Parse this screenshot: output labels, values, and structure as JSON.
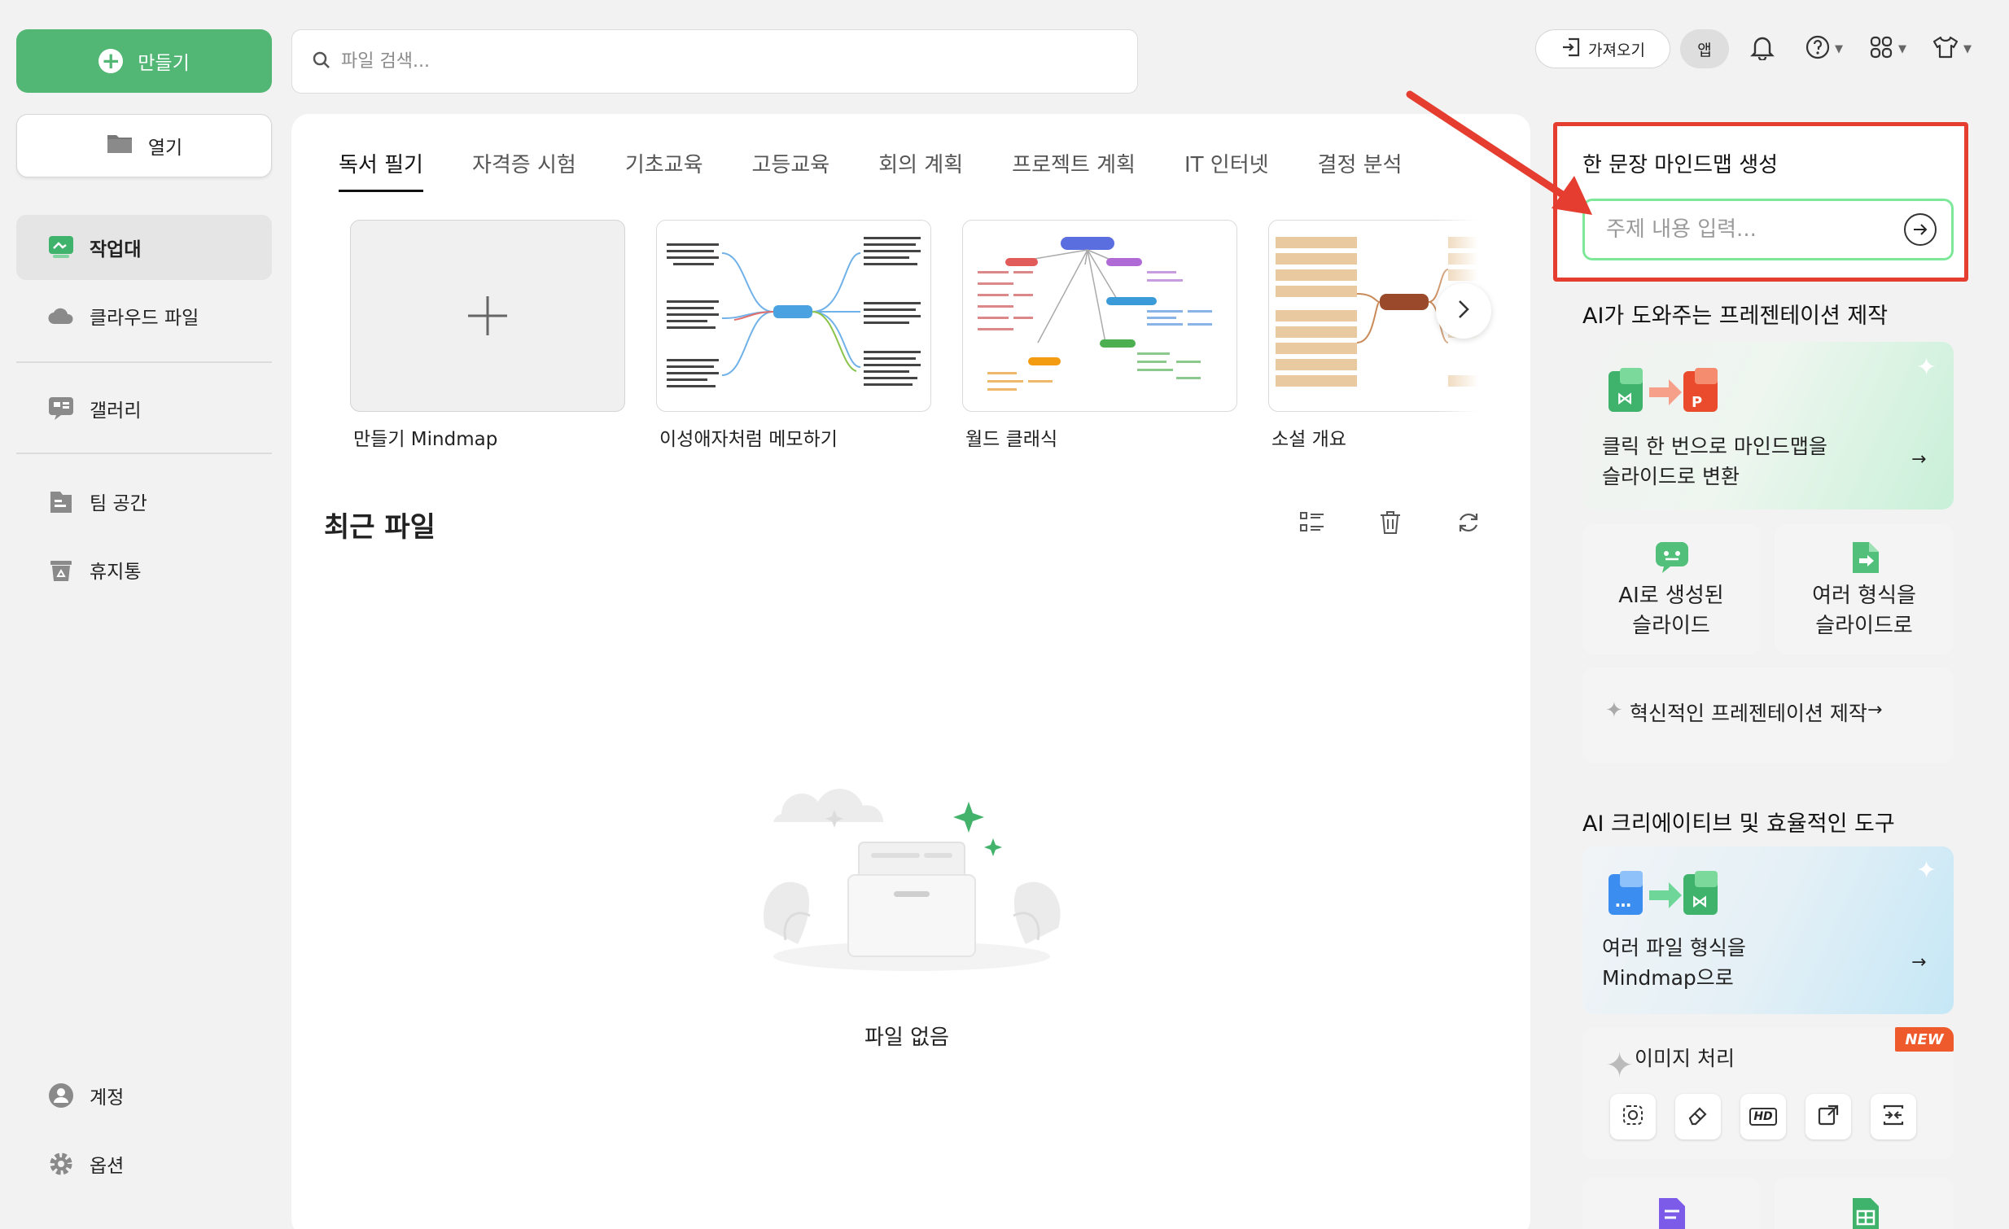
{
  "sidebar": {
    "create_label": "만들기",
    "open_label": "열기",
    "items": [
      {
        "label": "작업대"
      },
      {
        "label": "클라우드 파일"
      },
      {
        "label": "갤러리"
      },
      {
        "label": "팀 공간"
      },
      {
        "label": "휴지통"
      }
    ],
    "bottom": [
      {
        "label": "계정"
      },
      {
        "label": "옵션"
      }
    ]
  },
  "search": {
    "placeholder": "파일 검색..."
  },
  "topbar": {
    "import_label": "가져오기",
    "app_label": "앱"
  },
  "tabs": [
    "독서 필기",
    "자격증 시험",
    "기초교육",
    "고등교육",
    "회의 계획",
    "프로젝트 계획",
    "IT 인터넷",
    "결정 분석"
  ],
  "templates": [
    {
      "label": "만들기 Mindmap"
    },
    {
      "label": "이성애자처럼 메모하기"
    },
    {
      "label": "월드 클래식"
    },
    {
      "label": "소설 개요"
    }
  ],
  "recent": {
    "title": "최근 파일",
    "empty_text": "파일 없음"
  },
  "right_panel": {
    "ai_mindmap": {
      "title": "한 문장 마인드맵 생성",
      "input_placeholder": "주제 내용 입력..."
    },
    "presentation": {
      "title": "AI가 도와주는 프레젠테이션 제작",
      "convert_card": {
        "line1": "클릭 한 번으로 마인드맵을",
        "line2": "슬라이드로 변환"
      },
      "ai_slides": {
        "line1": "AI로 생성된",
        "line2": "슬라이드"
      },
      "multi_format": {
        "line1": "여러 형식을",
        "line2": "슬라이드로"
      },
      "innovative": "혁신적인 프레젠테이션 제작"
    },
    "tools": {
      "title": "AI 크리에이티브 및 효율적인 도구",
      "file_to_mindmap": {
        "line1": "여러 파일 형식을",
        "line2": "Mindmap으로"
      },
      "image_processing": {
        "title": "이미지 처리",
        "badge": "NEW",
        "hd_label": "HD"
      }
    }
  },
  "colors": {
    "brand_green": "#52b774",
    "highlight_red": "#e53d2f",
    "badge_orange": "#ef5a2c"
  }
}
